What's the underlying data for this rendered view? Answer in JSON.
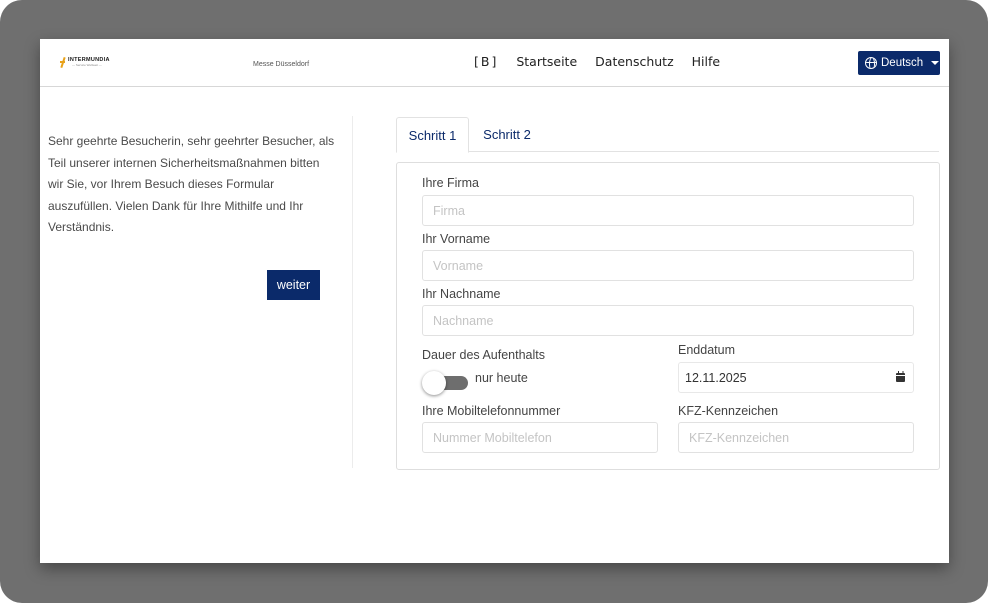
{
  "header": {
    "logo_name": "INTERMUNDIA",
    "logo_sub": "— Service Weltweit —",
    "venue": "Messe Düsseldorf",
    "nav": [
      "[B]",
      "Startseite",
      "Datenschutz",
      "Hilfe"
    ],
    "language_label": "Deutsch",
    "accent_color": "#0b2a6a"
  },
  "intro": {
    "text": "Sehr geehrte Besucherin, sehr geehrter Besucher, als Teil unserer internen Sicherheitsmaßnahmen bitten wir Sie, vor Ihrem Besuch dieses Formular auszufüllen. Vielen Dank für Ihre Mithilfe und Ihr Verständnis.",
    "next_button": "weiter"
  },
  "tabs": [
    "Schritt 1",
    "Schritt 2"
  ],
  "form": {
    "company_label": "Ihre Firma",
    "company_placeholder": "Firma",
    "firstname_label": "Ihr Vorname",
    "firstname_placeholder": "Vorname",
    "lastname_label": "Ihr Nachname",
    "lastname_placeholder": "Nachname",
    "duration_label": "Dauer des Aufenthalts",
    "today_only_label": "nur heute",
    "today_only_enabled": false,
    "end_date_label": "Enddatum",
    "end_date_value": "12.11.2025",
    "mobile_label": "Ihre Mobiltelefonnummer",
    "mobile_placeholder": "Nummer Mobiltelefon",
    "plate_label": "KFZ-Kennzeichen",
    "plate_placeholder": "KFZ-Kennzeichen"
  }
}
